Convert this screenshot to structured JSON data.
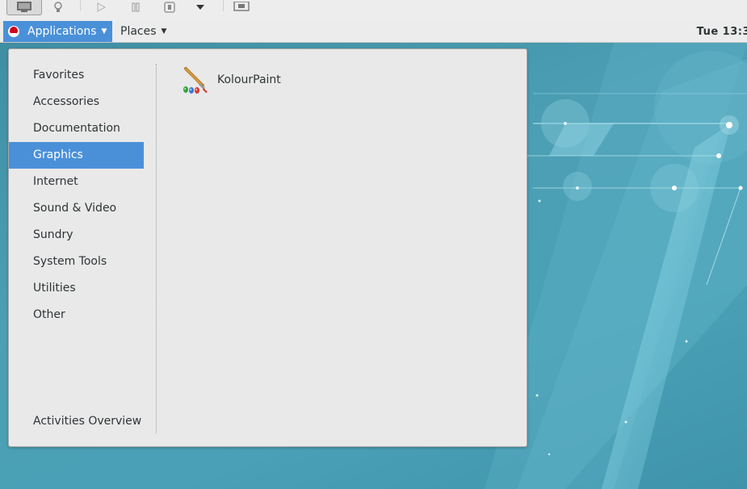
{
  "topbar": {
    "applications_label": "Applications",
    "places_label": "Places",
    "clock": "Tue 13:3"
  },
  "menu": {
    "categories": [
      {
        "label": "Favorites"
      },
      {
        "label": "Accessories"
      },
      {
        "label": "Documentation"
      },
      {
        "label": "Graphics",
        "selected": true
      },
      {
        "label": "Internet"
      },
      {
        "label": "Sound & Video"
      },
      {
        "label": "Sundry"
      },
      {
        "label": "System Tools"
      },
      {
        "label": "Utilities"
      },
      {
        "label": "Other"
      }
    ],
    "activities_label": "Activities Overview",
    "apps": [
      {
        "label": "KolourPaint",
        "icon": "paintbrush-icon"
      }
    ]
  },
  "colors": {
    "accent": "#4a90d9",
    "menu_bg": "#e9e9e9",
    "desktop": "#4a9cb2"
  }
}
